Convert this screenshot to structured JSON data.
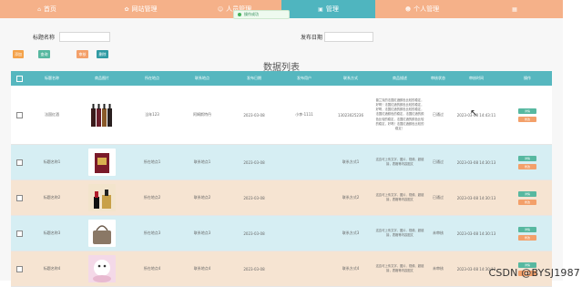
{
  "nav": {
    "items": [
      {
        "label": "首页",
        "icon": "home-icon",
        "bg": "#f5b189"
      },
      {
        "label": "网站管理",
        "icon": "settings-icon",
        "bg": "#f5b189"
      },
      {
        "label": "人员管理",
        "icon": "user-icon",
        "bg": "#f5b189"
      },
      {
        "label": "管理",
        "icon": "folder-icon",
        "bg": "#4fb5bf"
      },
      {
        "label": "个人管理",
        "icon": "person-icon",
        "bg": "#f5b189"
      },
      {
        "label": "",
        "icon": "avatar-icon",
        "bg": "#f5b189"
      }
    ],
    "toast": "操作成功"
  },
  "search": {
    "title_label": "标题名称",
    "date_label": "发布日期",
    "title_value": "",
    "date_value": ""
  },
  "toolbar": {
    "btn1": "添加",
    "btn2": "查询",
    "btn3": "审核",
    "btn4": "删除"
  },
  "table": {
    "title": "数据列表",
    "headers": [
      "标题名称",
      "商品图片",
      "所在地点",
      "联系地点",
      "发布日期",
      "发布用户",
      "联系方式",
      "商品描述",
      "审核状态",
      "审核时间",
      "操作"
    ],
    "rows": [
      {
        "title": "法国红酒",
        "image": "wine-bottles-image",
        "loc": "当年123",
        "contact": "阿姆斯特丹",
        "date": "2023-03-08",
        "user": "小李-1111",
        "phone": "13023025236",
        "desc": "普兰克的法国红酒颜色比较的稳定，好喝！法国红酒的颜色比较的稳定，好喝，法国红酒的颜色比较的稳定，法国红酒颜色的稳定，法国红酒的颜色比较的稳定，法国红酒的颜色比较的稳定，好喝！法国红酒颜色比较的稳定！",
        "status": "已通过",
        "time": "2023-03-08 14:43:11",
        "bg": "white"
      },
      {
        "title": "标题名称1",
        "image": "gift-box-image",
        "loc": "所在地点1",
        "contact": "联系地点1",
        "date": "2023-03-08",
        "user": "",
        "phone": "联系方式1",
        "desc": "这边可上传文字、图片、视频、超链接，表格等内容图文",
        "status": "已通过",
        "time": "2023-03-08 14:30:13",
        "bg": "blue"
      },
      {
        "title": "标题名称2",
        "image": "lipstick-image",
        "loc": "所在地点2",
        "contact": "联系地点2",
        "date": "2023-03-08",
        "user": "",
        "phone": "联系方式2",
        "desc": "这边可上传文字、图片、视频、超链接，表格等内容图文",
        "status": "已通过",
        "time": "2023-03-08 14:30:13",
        "bg": "peach"
      },
      {
        "title": "标题名称3",
        "image": "handbag-image",
        "loc": "所在地点3",
        "contact": "联系地点3",
        "date": "2023-03-08",
        "user": "",
        "phone": "联系方式3",
        "desc": "这边可上传文字、图片、视频、超链接，表格等内容图文",
        "status": "未审核",
        "time": "2023-03-08 14:30:13",
        "bg": "blue"
      },
      {
        "title": "标题名称4",
        "image": "toy-image",
        "loc": "所在地点4",
        "contact": "联系地点4",
        "date": "2023-03-08",
        "user": "",
        "phone": "联系方式4",
        "desc": "这边可上传文字、图片、视频、超链接，表格等内容图文",
        "status": "未审核",
        "time": "2023-03-08 14:30:13",
        "bg": "peach"
      }
    ],
    "view_label": "详情",
    "edit_label": "修改"
  },
  "watermark": "CSDN @BYSJ1987"
}
